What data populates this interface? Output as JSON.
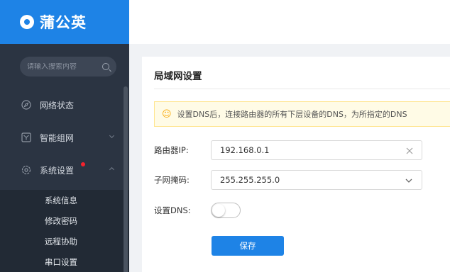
{
  "brand": {
    "name": "蒲公英"
  },
  "search": {
    "placeholder": "请输入搜索内容"
  },
  "nav": {
    "items": [
      {
        "label": "网络状态",
        "icon": "compass-icon"
      },
      {
        "label": "智能组网",
        "icon": "network-icon",
        "expandable": true
      },
      {
        "label": "系统设置",
        "icon": "settings-icon",
        "expandable": true,
        "expanded": true,
        "badge": true
      }
    ],
    "submenu": [
      {
        "label": "系统信息"
      },
      {
        "label": "修改密码"
      },
      {
        "label": "远程协助"
      },
      {
        "label": "串口设置"
      }
    ]
  },
  "page": {
    "title": "局域网设置",
    "notice": "设置DNS后，连接路由器的所有下层设备的DNS，为所指定的DNS"
  },
  "form": {
    "router_ip": {
      "label": "路由器IP:",
      "value": "192.168.0.1"
    },
    "subnet_mask": {
      "label": "子网掩码:",
      "value": "255.255.255.0"
    },
    "dns": {
      "label": "设置DNS:",
      "enabled": false
    }
  },
  "actions": {
    "save_label": "保存"
  },
  "colors": {
    "accent": "#1e83e6",
    "sidebar": "#2b3442",
    "notice_bg": "#fffbe6",
    "notice_border": "#ffe58f",
    "badge": "#f5222d"
  }
}
